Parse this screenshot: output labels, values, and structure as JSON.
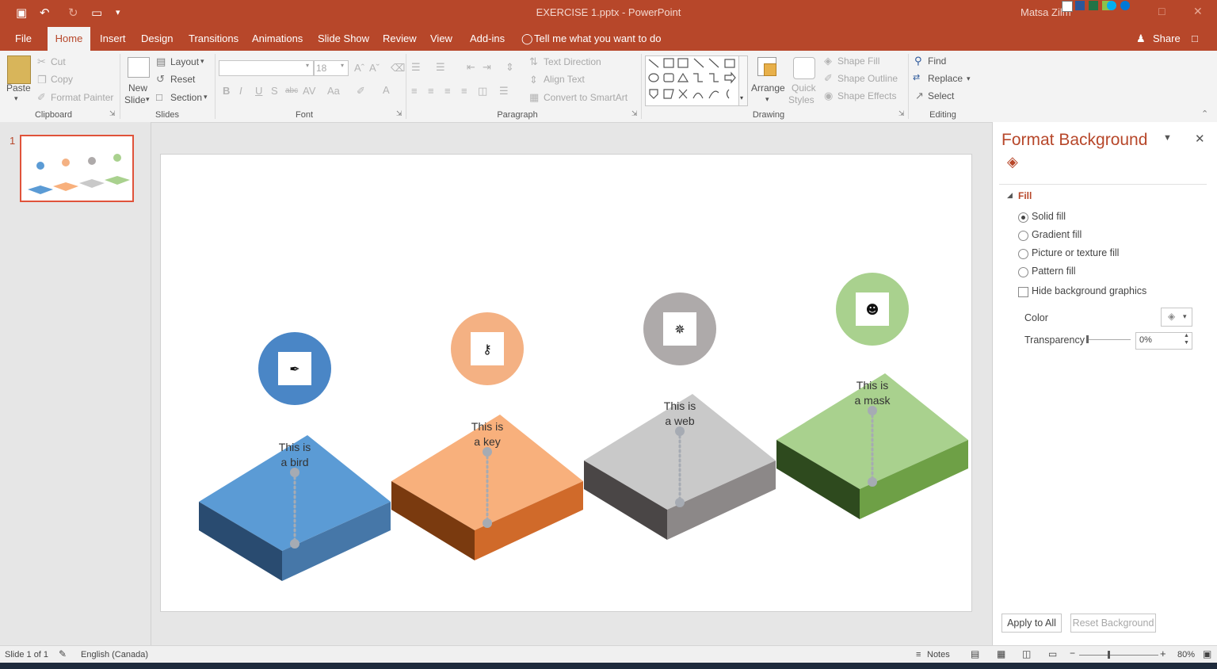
{
  "titlebar": {
    "title": "EXERCISE 1.pptx  -  PowerPoint",
    "user": "Matsa Zilm",
    "save_icon": "▣",
    "undo_icon": "↶",
    "redo_icon": "↻",
    "present_icon": "▭",
    "customize_icon": "▾"
  },
  "tabs": {
    "file": "File",
    "home": "Home",
    "insert": "Insert",
    "design": "Design",
    "transitions": "Transitions",
    "animations": "Animations",
    "slideshow": "Slide Show",
    "review": "Review",
    "view": "View",
    "addins": "Add-ins",
    "tellme": "Tell me what you want to do",
    "share": "Share"
  },
  "ribbon": {
    "clipboard": {
      "paste": "Paste",
      "cut": "Cut",
      "copy": "Copy",
      "format_painter": "Format Painter",
      "label": "Clipboard"
    },
    "slides": {
      "new_slide_1": "New",
      "new_slide_2": "Slide",
      "layout": "Layout",
      "reset": "Reset",
      "section": "Section",
      "label": "Slides"
    },
    "font": {
      "size": "18",
      "label": "Font"
    },
    "paragraph": {
      "text_direction": "Text Direction",
      "align_text": "Align Text",
      "smartart": "Convert to SmartArt",
      "label": "Paragraph"
    },
    "drawing": {
      "arrange": "Arrange",
      "quick_1": "Quick",
      "quick_2": "Styles",
      "shape_fill": "Shape Fill",
      "shape_outline": "Shape Outline",
      "shape_effects": "Shape Effects",
      "label": "Drawing"
    },
    "editing": {
      "find": "Find",
      "replace": "Replace",
      "select": "Select",
      "label": "Editing"
    }
  },
  "thumbnail": {
    "number": "1"
  },
  "slide": {
    "steps": [
      {
        "line1": "This is",
        "line2": "a bird",
        "icon": "bird-icon",
        "glyph": "✒",
        "circle_color": "#4a86c6",
        "top_color": "#5b9bd5",
        "left_color": "#294b70",
        "right_color": "#4677a8"
      },
      {
        "line1": "This is",
        "line2": "a key",
        "icon": "key-icon",
        "glyph": "⚷",
        "circle_color": "#f4b183",
        "top_color": "#f8b07c",
        "left_color": "#7a3a0f",
        "right_color": "#d06a2a"
      },
      {
        "line1": "This is",
        "line2": "a web",
        "icon": "web-icon",
        "glyph": "✵",
        "circle_color": "#aeaaaa",
        "top_color": "#c9c9c9",
        "left_color": "#4a4646",
        "right_color": "#8c8888"
      },
      {
        "line1": "This is",
        "line2": "a mask",
        "icon": "mask-icon",
        "glyph": "☻",
        "circle_color": "#a9d18e",
        "top_color": "#a9d18e",
        "left_color": "#2e4a1e",
        "right_color": "#6ea046"
      }
    ]
  },
  "format_pane": {
    "title": "Format Background",
    "fill_header": "Fill",
    "solid_fill": "Solid fill",
    "gradient_fill": "Gradient fill",
    "picture_fill": "Picture or texture fill",
    "pattern_fill": "Pattern fill",
    "hide_graphics": "Hide background graphics",
    "color_label": "Color",
    "transparency_label": "Transparency",
    "transparency_value": "0%",
    "apply_all": "Apply to All",
    "reset_bg": "Reset Background"
  },
  "statusbar": {
    "slide_info": "Slide 1 of 1",
    "language": "English (Canada)",
    "notes": "Notes",
    "zoom": "80%"
  },
  "colors": {
    "accent": "#b7472a"
  }
}
